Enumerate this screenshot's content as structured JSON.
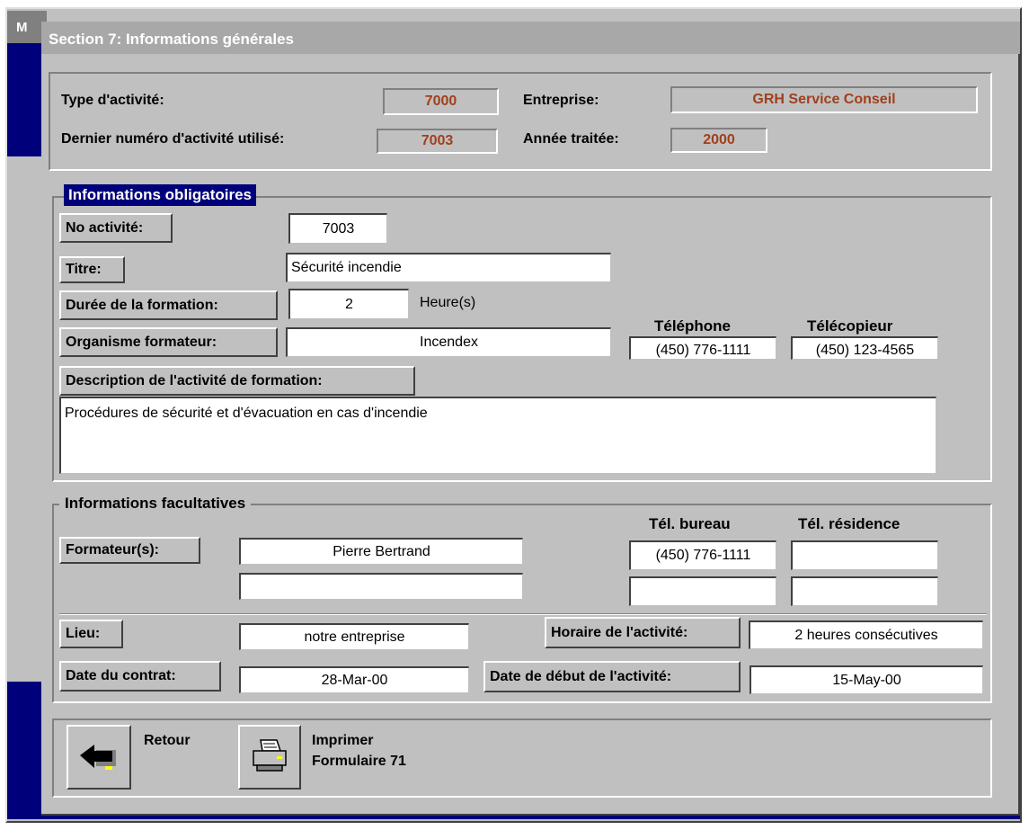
{
  "app": {
    "title_stub": "M"
  },
  "window": {
    "title": "Section 7: Informations générales"
  },
  "header": {
    "type_activite_label": "Type d'activité:",
    "type_activite_value": "7000",
    "entreprise_label": "Entreprise:",
    "entreprise_value": "GRH Service Conseil",
    "dernier_numero_label": "Dernier numéro d'activité utilisé:",
    "dernier_numero_value": "7003",
    "annee_label": "Année traitée:",
    "annee_value": "2000"
  },
  "obligatoires": {
    "legend": "Informations obligatoires",
    "no_activite_button": "No activité:",
    "no_activite_value": "7003",
    "titre_button": "Titre:",
    "titre_value": "Sécurité incendie",
    "duree_button": "Durée de la formation:",
    "duree_value": "2",
    "duree_unit": "Heure(s)",
    "organisme_button": "Organisme formateur:",
    "organisme_value": "Incendex",
    "telephone_label": "Téléphone",
    "telephone_value": "(450) 776-1111",
    "telecopieur_label": "Télécopieur",
    "telecopieur_value": "(450) 123-4565",
    "description_button": "Description de l'activité de formation:",
    "description_value": "Procédures de sécurité et d'évacuation en cas d'incendie"
  },
  "facultatives": {
    "legend": "Informations facultatives",
    "tel_bureau_label": "Tél. bureau",
    "tel_residence_label": "Tél. résidence",
    "formateurs_button": "Formateur(s):",
    "formateurs": [
      {
        "name": "Pierre Bertrand",
        "tel_bureau": "(450) 776-1111",
        "tel_residence": ""
      },
      {
        "name": "",
        "tel_bureau": "",
        "tel_residence": ""
      }
    ],
    "lieu_button": "Lieu:",
    "lieu_value": "notre entreprise",
    "horaire_button": "Horaire de l'activité:",
    "horaire_value": "2 heures consécutives",
    "date_contrat_button": "Date du contrat:",
    "date_contrat_value": "28-Mar-00",
    "date_debut_button": "Date de début de l'activité:",
    "date_debut_value": "15-May-00"
  },
  "footer": {
    "retour_label": "Retour",
    "imprimer_line1": "Imprimer",
    "imprimer_line2": "Formulaire 71"
  },
  "colors": {
    "header_value": "#a0401c",
    "legend_bg": "#00007b",
    "face": "#c0c0c0"
  }
}
